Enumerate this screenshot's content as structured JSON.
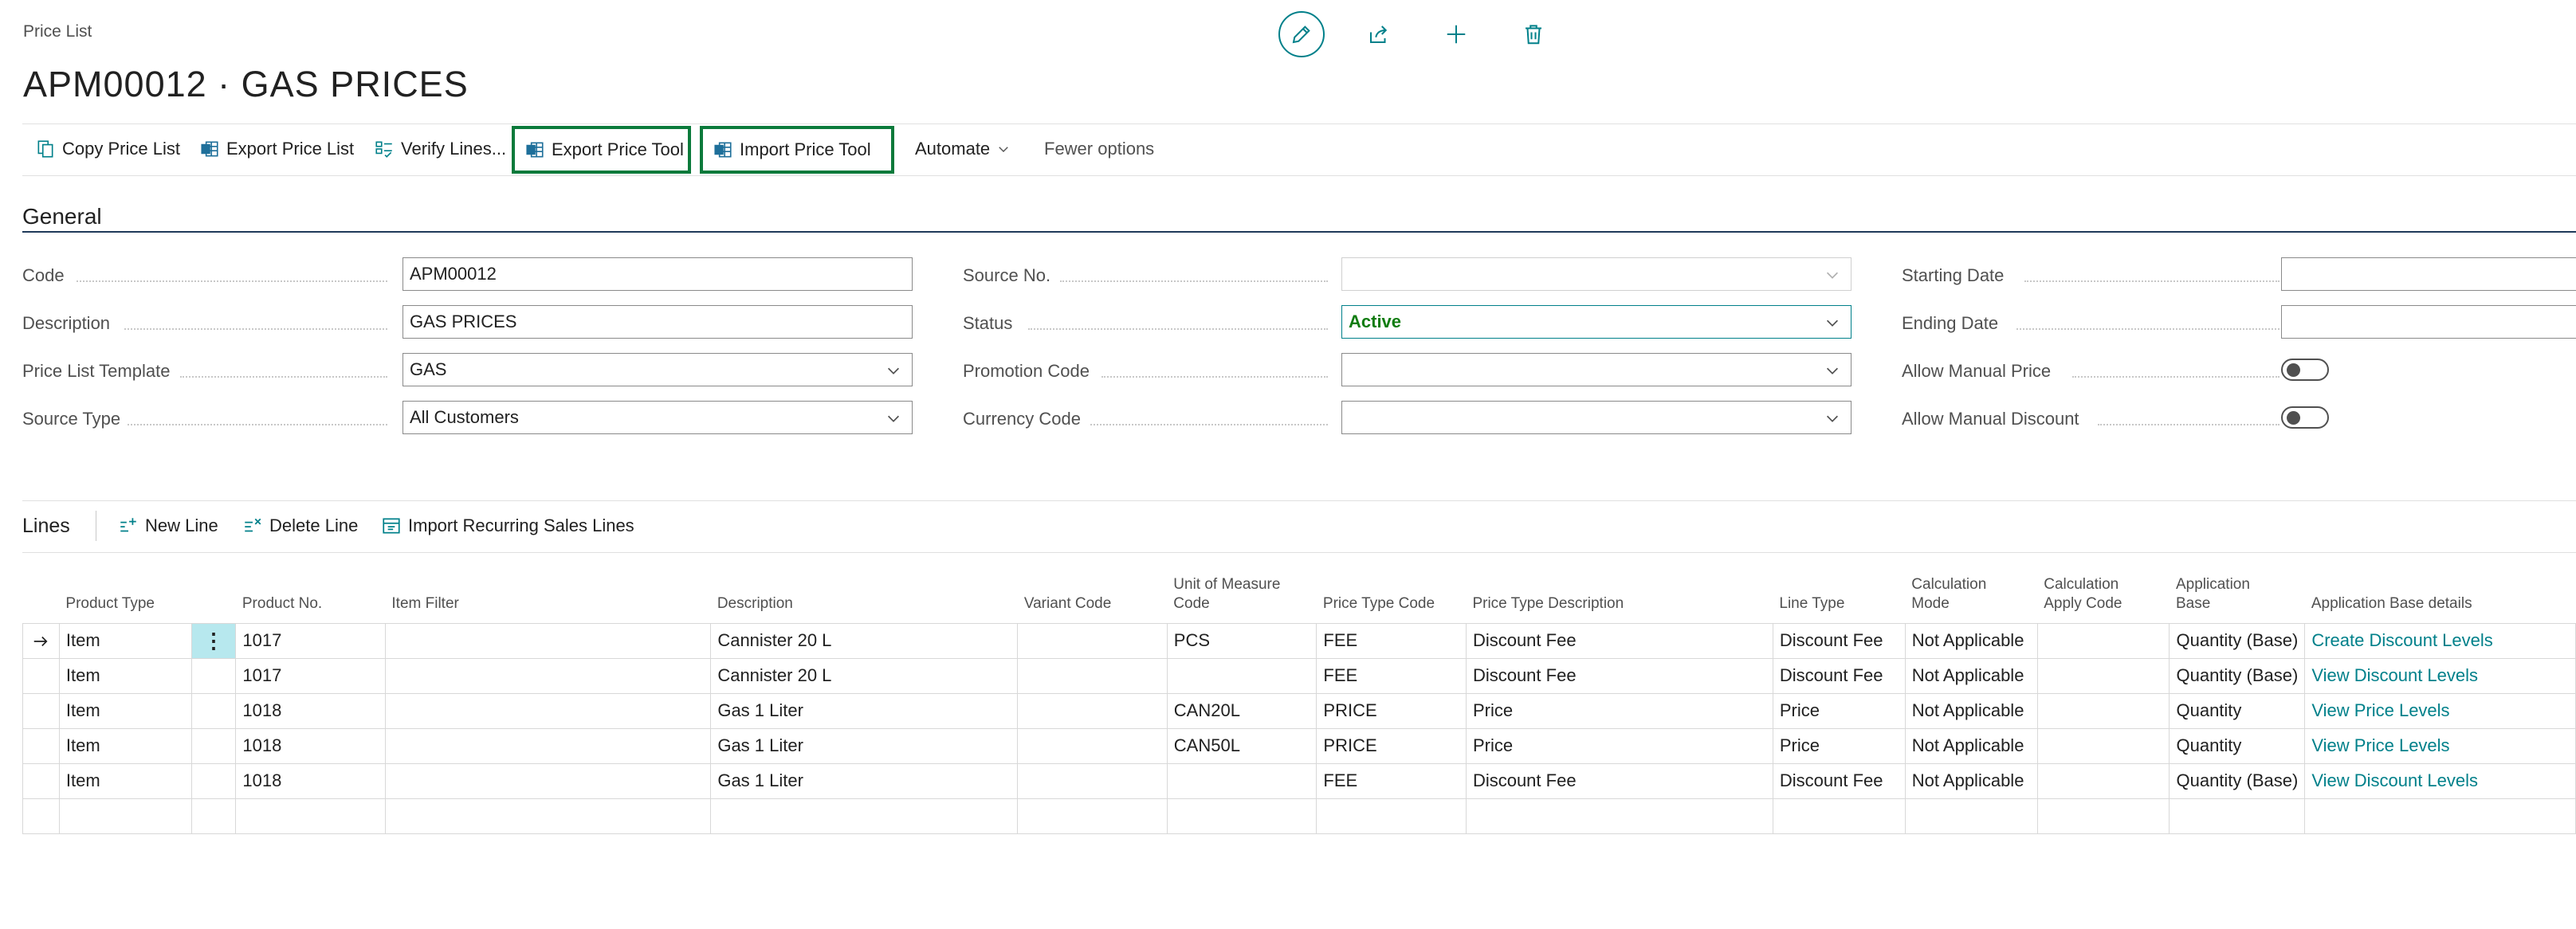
{
  "page": {
    "breadcrumb": "Price List",
    "title": "APM00012 · GAS PRICES"
  },
  "header_actions": [
    "edit-icon",
    "share-icon",
    "add-icon",
    "delete-icon"
  ],
  "actionbar": {
    "copy_price_list": "Copy Price List",
    "export_price_list": "Export Price List",
    "verify_lines": "Verify Lines...",
    "export_price_tool": "Export Price Tool",
    "import_price_tool": "Import Price Tool",
    "automate": "Automate",
    "fewer_options": "Fewer options"
  },
  "general": {
    "title": "General",
    "code": {
      "label": "Code",
      "value": "APM00012"
    },
    "description": {
      "label": "Description",
      "value": "GAS PRICES"
    },
    "price_list_template": {
      "label": "Price List Template",
      "value": "GAS"
    },
    "source_type": {
      "label": "Source Type",
      "value": "All Customers"
    },
    "source_no": {
      "label": "Source No.",
      "value": ""
    },
    "status": {
      "label": "Status",
      "value": "Active"
    },
    "promotion_code": {
      "label": "Promotion Code",
      "value": ""
    },
    "currency_code": {
      "label": "Currency Code",
      "value": ""
    },
    "starting_date": {
      "label": "Starting Date",
      "value": ""
    },
    "ending_date": {
      "label": "Ending Date",
      "value": ""
    },
    "allow_manual_price": {
      "label": "Allow Manual Price",
      "value": false
    },
    "allow_manual_discount": {
      "label": "Allow Manual Discount",
      "value": false
    }
  },
  "lines": {
    "title": "Lines",
    "new_line": "New Line",
    "delete_line": "Delete Line",
    "import_recurring": "Import Recurring Sales Lines",
    "columns": {
      "product_type": "Product Type",
      "product_no": "Product No.",
      "item_filter": "Item Filter",
      "description": "Description",
      "variant_code": "Variant Code",
      "uom_code_1": "Unit of Measure",
      "uom_code_2": "Code",
      "price_type_code": "Price Type Code",
      "price_type_description": "Price Type Description",
      "line_type": "Line Type",
      "calc_mode_1": "Calculation",
      "calc_mode_2": "Mode",
      "calc_apply_1": "Calculation",
      "calc_apply_2": "Apply Code",
      "app_base_1": "Application",
      "app_base_2": "Base",
      "app_base_details": "Application Base details"
    },
    "rows": [
      {
        "product_type": "Item",
        "product_no": "1017",
        "item_filter": "",
        "description": "Cannister 20 L",
        "variant_code": "",
        "uom": "PCS",
        "price_type_code": "FEE",
        "price_type_description": "Discount Fee",
        "line_type": "Discount Fee",
        "calc_mode": "Not Applicable",
        "calc_apply": "",
        "app_base": "Quantity (Base)",
        "details": "Create Discount Levels"
      },
      {
        "product_type": "Item",
        "product_no": "1017",
        "item_filter": "",
        "description": "Cannister 20 L",
        "variant_code": "",
        "uom": "",
        "price_type_code": "FEE",
        "price_type_description": "Discount Fee",
        "line_type": "Discount Fee",
        "calc_mode": "Not Applicable",
        "calc_apply": "",
        "app_base": "Quantity (Base)",
        "details": "View Discount Levels"
      },
      {
        "product_type": "Item",
        "product_no": "1018",
        "item_filter": "",
        "description": "Gas 1 Liter",
        "variant_code": "",
        "uom": "CAN20L",
        "price_type_code": "PRICE",
        "price_type_description": "Price",
        "line_type": "Price",
        "calc_mode": "Not Applicable",
        "calc_apply": "",
        "app_base": "Quantity",
        "details": "View Price Levels"
      },
      {
        "product_type": "Item",
        "product_no": "1018",
        "item_filter": "",
        "description": "Gas 1 Liter",
        "variant_code": "",
        "uom": "CAN50L",
        "price_type_code": "PRICE",
        "price_type_description": "Price",
        "line_type": "Price",
        "calc_mode": "Not Applicable",
        "calc_apply": "",
        "app_base": "Quantity",
        "details": "View Price Levels"
      },
      {
        "product_type": "Item",
        "product_no": "1018",
        "item_filter": "",
        "description": "Gas 1 Liter",
        "variant_code": "",
        "uom": "",
        "price_type_code": "FEE",
        "price_type_description": "Discount Fee",
        "line_type": "Discount Fee",
        "calc_mode": "Not Applicable",
        "calc_apply": "",
        "app_base": "Quantity (Base)",
        "details": "View Discount Levels"
      }
    ]
  },
  "colors": {
    "accent": "#00808a",
    "highlight_border": "#0b7a3b",
    "status_active": "#107c10"
  }
}
